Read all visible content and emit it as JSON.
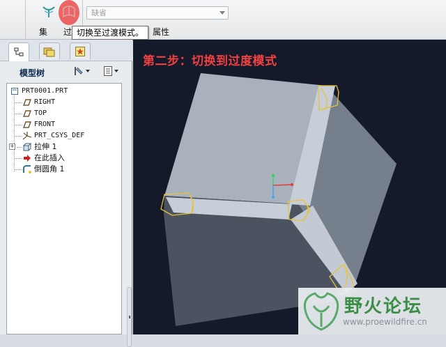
{
  "ribbon": {
    "combo_value": "缺省",
    "label_set": "集",
    "label_transition": "过",
    "label_properties": "属性",
    "tooltip": "切换至过渡模式。"
  },
  "panel": {
    "title": "模型树",
    "tree": [
      {
        "label": "PRT0001.PRT",
        "icon": "part-icon"
      },
      {
        "label": "RIGHT",
        "icon": "datum-plane-icon"
      },
      {
        "label": "TOP",
        "icon": "datum-plane-icon"
      },
      {
        "label": "FRONT",
        "icon": "datum-plane-icon"
      },
      {
        "label": "PRT_CSYS_DEF",
        "icon": "csys-icon"
      },
      {
        "label": "拉伸 1",
        "icon": "extrude-icon"
      },
      {
        "label": "在此插入",
        "icon": "insert-here-arrow-icon"
      },
      {
        "label": "倒圆角 1",
        "icon": "round-icon"
      }
    ]
  },
  "viewport": {
    "step_label": "第二步：切换到过度模式",
    "watermark_name": "野火论坛",
    "watermark_url": "www.proewildfire.cn"
  },
  "colors": {
    "viewport_bg": "#141a2a",
    "step_label": "#f04040",
    "selection_yellow": "#e6c23a",
    "watermark_green": "#3b8e45"
  }
}
